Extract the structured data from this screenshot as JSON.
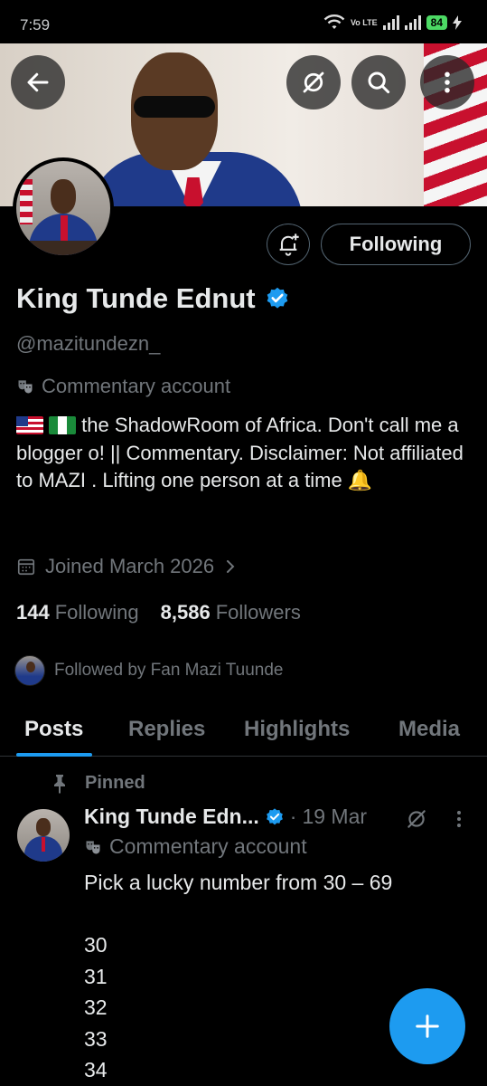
{
  "status_bar": {
    "time": "7:59",
    "volte": "Vo LTE",
    "battery": "84"
  },
  "header": {
    "icons": [
      "back-arrow-icon",
      "grok-icon",
      "search-icon",
      "more-vertical-icon"
    ]
  },
  "profile": {
    "follow_button": "Following",
    "display_name": "King Tunde Ednut",
    "verified": true,
    "handle": "@mazitundezn_",
    "category": "Commentary account",
    "bio": "the ShadowRoom of Africa. Don't call me a blogger o! || Commentary. Disclaimer: Not affiliated to MAZI . Lifting one person at a time",
    "bio_end_emoji": "🔔",
    "joined": "Joined March 2026",
    "following_count": "144",
    "following_label": "Following",
    "followers_count": "8,586",
    "followers_label": "Followers",
    "followed_by": "Followed by Fan Mazi Tuunde"
  },
  "tabs": [
    {
      "label": "Posts",
      "active": true
    },
    {
      "label": "Replies",
      "active": false
    },
    {
      "label": "Highlights",
      "active": false
    },
    {
      "label": "Media",
      "active": false
    }
  ],
  "pinned_tweet": {
    "pinned_label": "Pinned",
    "author": "King Tunde Edn...",
    "separator": "·",
    "date": "19 Mar",
    "category": "Commentary account",
    "text": "Pick a lucky number from 30 – 69\n\n30\n31\n32\n33\n34"
  },
  "colors": {
    "accent": "#1d9bf0",
    "muted": "#71767b",
    "text": "#e7e9ea",
    "background": "#000000"
  }
}
